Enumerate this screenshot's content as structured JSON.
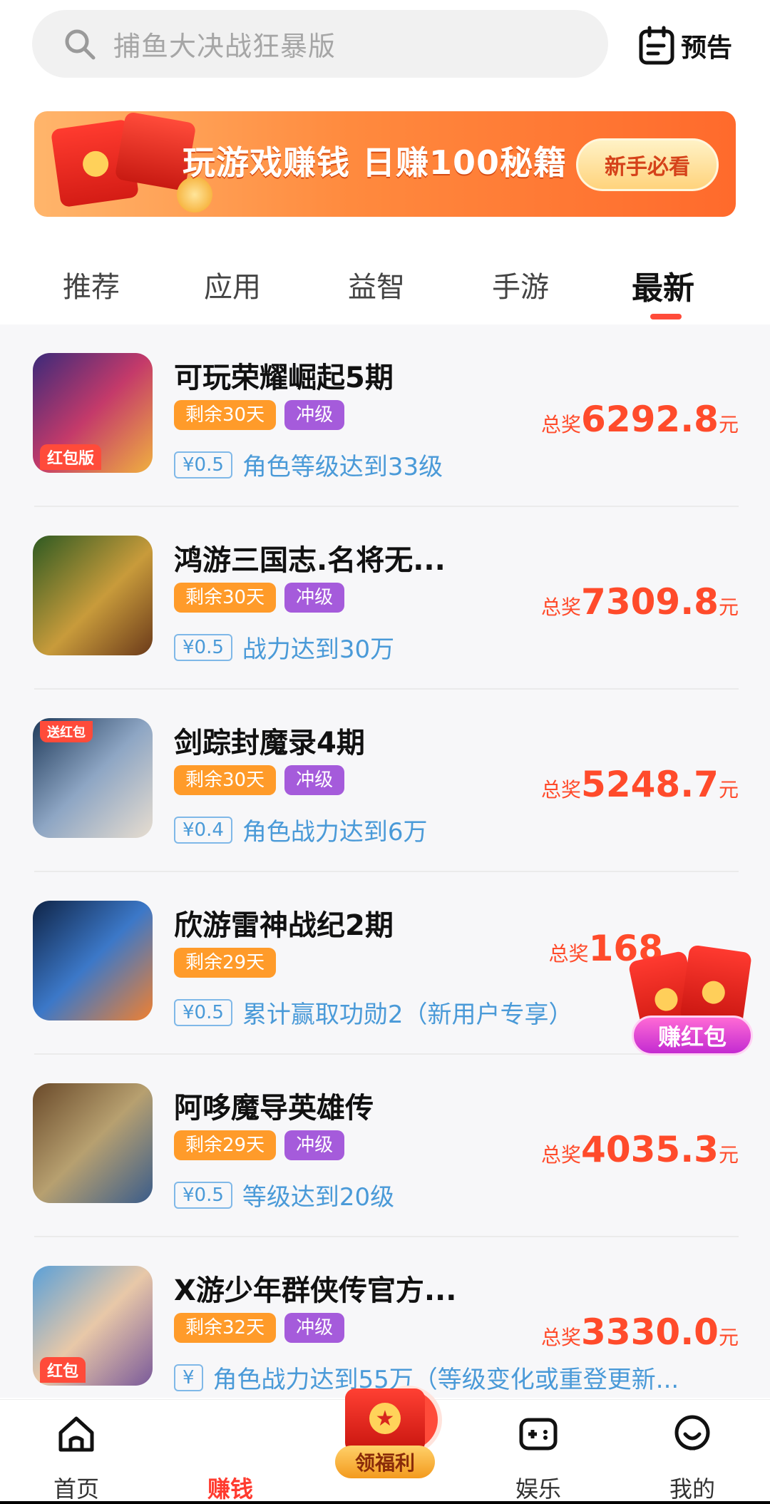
{
  "search": {
    "placeholder": "捕鱼大决战狂暴版"
  },
  "header": {
    "preview_label": "预告"
  },
  "banner": {
    "title": "玩游戏赚钱 日赚100秘籍",
    "cta": "新手必看"
  },
  "tabs": [
    {
      "label": "推荐",
      "active": false
    },
    {
      "label": "应用",
      "active": false
    },
    {
      "label": "益智",
      "active": false
    },
    {
      "label": "手游",
      "active": false
    },
    {
      "label": "最新",
      "active": true
    }
  ],
  "list": {
    "items": [
      {
        "name": "可玩荣耀崛起5期",
        "days": "剩余30天",
        "level": "冲级",
        "reward": "¥0.5",
        "task": "角色等级达到33级",
        "prize_label": "总奖",
        "prize": "6292.8",
        "unit": "元",
        "thumb_tag": "红包版"
      },
      {
        "name": "鸿游三国志.名将无...",
        "days": "剩余30天",
        "level": "冲级",
        "reward": "¥0.5",
        "task": "战力达到30万",
        "prize_label": "总奖",
        "prize": "7309.8",
        "unit": "元",
        "thumb_tag": ""
      },
      {
        "name": "剑踪封魔录4期",
        "days": "剩余30天",
        "level": "冲级",
        "reward": "¥0.4",
        "task": "角色战力达到6万",
        "prize_label": "总奖",
        "prize": "5248.7",
        "unit": "元",
        "thumb_tag": "送红包"
      },
      {
        "name": "欣游雷神战纪2期",
        "days": "剩余29天",
        "level": "",
        "reward": "¥0.5",
        "task": "累计赢取功勋2（新用户专享）",
        "prize_label": "总奖",
        "prize": "168",
        "unit": "",
        "thumb_tag": ""
      },
      {
        "name": "阿哆魔导英雄传",
        "days": "剩余29天",
        "level": "冲级",
        "reward": "¥0.5",
        "task": "等级达到20级",
        "prize_label": "总奖",
        "prize": "4035.3",
        "unit": "元",
        "thumb_tag": ""
      },
      {
        "name": "X游少年群侠传官方...",
        "days": "剩余32天",
        "level": "冲级",
        "reward": "¥",
        "task": "角色战力达到55万（等级变化或重登更新...",
        "prize_label": "总奖",
        "prize": "3330.0",
        "unit": "元",
        "thumb_tag": "红包"
      }
    ]
  },
  "float": {
    "label": "赚红包"
  },
  "bottom_nav": [
    {
      "label": "首页",
      "icon": "home-icon",
      "active": false
    },
    {
      "label": "赚钱",
      "icon": "yen-icon",
      "active": true
    },
    {
      "label": "领福利",
      "icon": "gift-icon",
      "active": false
    },
    {
      "label": "娱乐",
      "icon": "gamepad-icon",
      "active": false
    },
    {
      "label": "我的",
      "icon": "profile-icon",
      "active": false
    }
  ],
  "colors": {
    "accent": "#ff4b3a",
    "days_badge": "#ff9b2a",
    "level_badge": "#a55bdb",
    "task_blue": "#4a9ad8"
  }
}
